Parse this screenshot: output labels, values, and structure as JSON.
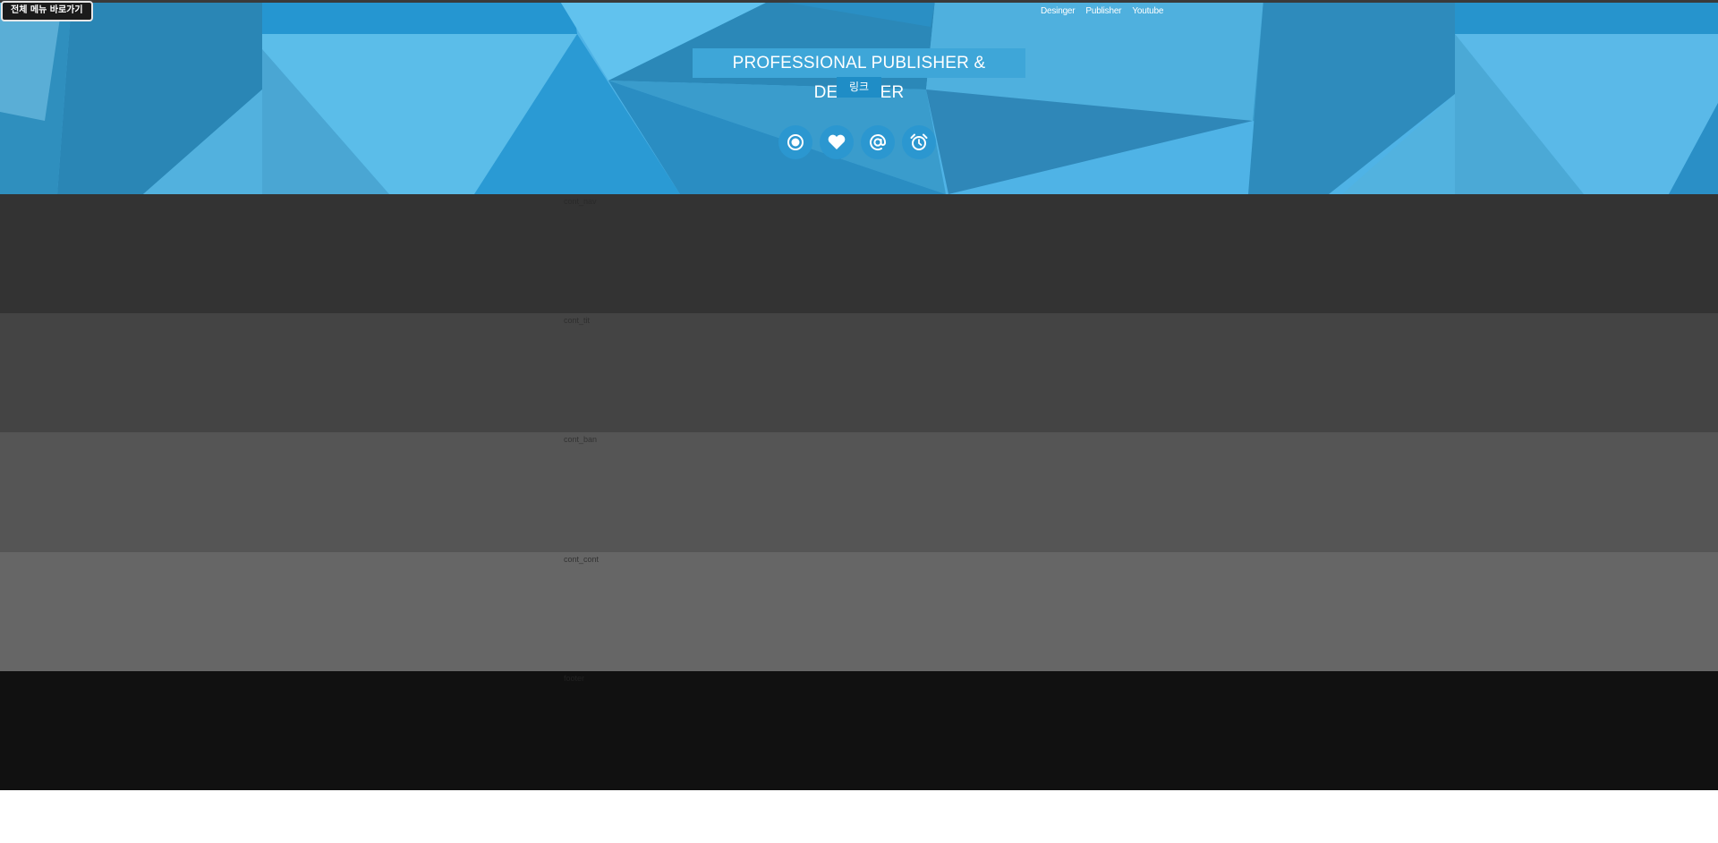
{
  "skip_link": "전체 메뉴 바로가기",
  "header": {
    "nav": [
      "Desinger",
      "Publisher",
      "Youtube"
    ],
    "title": "PROFESSIONAL PUBLISHER & DESIGNER",
    "link_label": "링크",
    "icons": [
      "record-icon",
      "heart-icon",
      "at-sign-icon",
      "alarm-clock-icon"
    ]
  },
  "sections": [
    {
      "label": "cont_nav",
      "bg": "#333333",
      "label_color": "#2a2a2a"
    },
    {
      "label": "cont_tit",
      "bg": "#444444",
      "label_color": "#2e2e2e"
    },
    {
      "label": "cont_ban",
      "bg": "#555555",
      "label_color": "#333333"
    },
    {
      "label": "cont_cont",
      "bg": "#666666",
      "label_color": "#333333"
    },
    {
      "label": "footer",
      "bg": "#111111",
      "label_color": "#222222"
    }
  ]
}
